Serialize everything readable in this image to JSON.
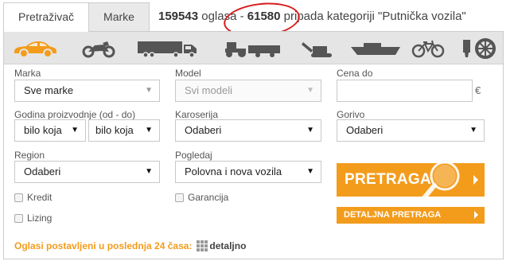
{
  "tabs": [
    {
      "label": "Pretraživač",
      "active": true
    },
    {
      "label": "Marke",
      "active": false
    }
  ],
  "summary": {
    "total": "159543",
    "text1": " oglasa - ",
    "category_count": "61580",
    "text2": " pripada kategoriji \"Putnička vozila\""
  },
  "categories": [
    {
      "icon": "car-icon",
      "selected": true
    },
    {
      "icon": "motorcycle-icon"
    },
    {
      "icon": "truck-icon"
    },
    {
      "icon": "tractor-icon"
    },
    {
      "icon": "excavator-icon"
    },
    {
      "icon": "boat-icon"
    },
    {
      "icon": "bicycle-icon"
    },
    {
      "icon": "parts-icon"
    }
  ],
  "form": {
    "marka": {
      "label": "Marka",
      "value": "Sve marke"
    },
    "model": {
      "label": "Model",
      "value": "Svi modeli",
      "disabled": true
    },
    "cena": {
      "label": "Cena do",
      "value": "",
      "currency": "€"
    },
    "godina": {
      "label": "Godina proizvodnje (od - do)",
      "from": "bilo koja",
      "to": "bilo koja"
    },
    "karoserija": {
      "label": "Karoserija",
      "value": "Odaberi"
    },
    "gorivo": {
      "label": "Gorivo",
      "value": "Odaberi"
    },
    "region": {
      "label": "Region",
      "value": "Odaberi"
    },
    "pogledaj": {
      "label": "Pogledaj",
      "value": "Polovna i nova vozila"
    },
    "kredit": {
      "label": "Kredit",
      "checked": false
    },
    "lizing": {
      "label": "Lizing",
      "checked": false
    },
    "garancija": {
      "label": "Garancija",
      "checked": false
    }
  },
  "buttons": {
    "search": "PRETRAGA",
    "detailed": "DETALJNA PRETRAGA"
  },
  "footer": {
    "recent": "Oglasi postavljeni u poslednja 24 časa:",
    "detaljno": "detaljno"
  },
  "colors": {
    "accent": "#f39c1c",
    "annotation": "#d81e1e"
  }
}
